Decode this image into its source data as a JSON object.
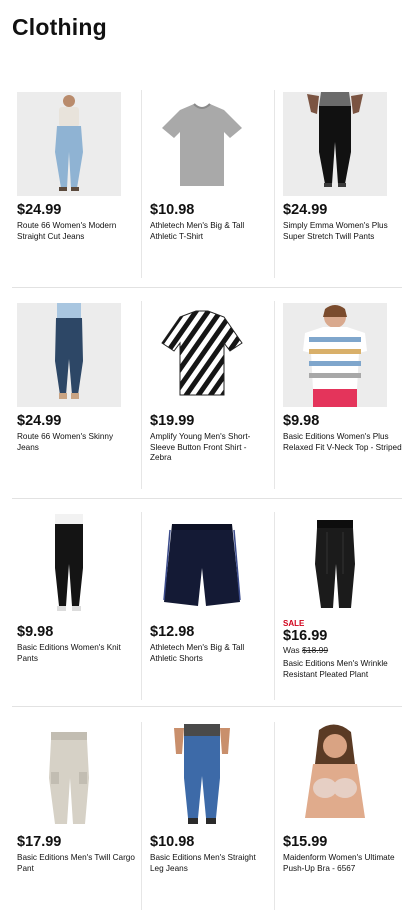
{
  "page": {
    "title": "Clothing"
  },
  "products": [
    {
      "price": "$24.99",
      "name": "Route 66 Women's Modern Straight Cut Jeans",
      "image": "womens-jeans-model"
    },
    {
      "price": "$10.98",
      "name": "Athletech Men's Big & Tall Athletic T-Shirt",
      "image": "gray-tshirt"
    },
    {
      "price": "$24.99",
      "name": "Simply Emma Women's Plus Super Stretch Twill Pants",
      "image": "black-pants-model"
    },
    {
      "price": "$24.99",
      "name": "Route 66 Women's Skinny Jeans",
      "image": "skinny-jeans-model"
    },
    {
      "price": "$19.99",
      "name": "Amplify Young Men's Short-Sleeve Button Front Shirt - Zebra",
      "image": "zebra-shirt"
    },
    {
      "price": "$9.98",
      "name": "Basic Editions Women's Plus Relaxed Fit V-Neck Top - Striped",
      "image": "striped-top-model"
    },
    {
      "price": "$9.98",
      "name": "Basic Editions Women's Knit Pants",
      "image": "knit-pants-model"
    },
    {
      "price": "$12.98",
      "name": "Athletech Men's Big & Tall Athletic Shorts",
      "image": "navy-shorts"
    },
    {
      "sale": "SALE",
      "price": "$16.99",
      "was_label": "Was",
      "was_price": "$18.99",
      "name": "Basic Editions Men's Wrinkle Resistant Pleated Plant",
      "image": "pleated-pants"
    },
    {
      "price": "$17.99",
      "name": "Basic Editions Men's Twill Cargo Pant",
      "image": "khaki-cargo-pants"
    },
    {
      "price": "$10.98",
      "name": "Basic Editions Men's Straight Leg Jeans",
      "image": "mens-jeans-model"
    },
    {
      "price": "$15.99",
      "name": "Maidenform Women's Ultimate Push-Up Bra - 6567",
      "image": "bra-model"
    }
  ],
  "colors": {
    "sale": "#d0021b",
    "text": "#111111",
    "divider": "#e2e2e2"
  }
}
